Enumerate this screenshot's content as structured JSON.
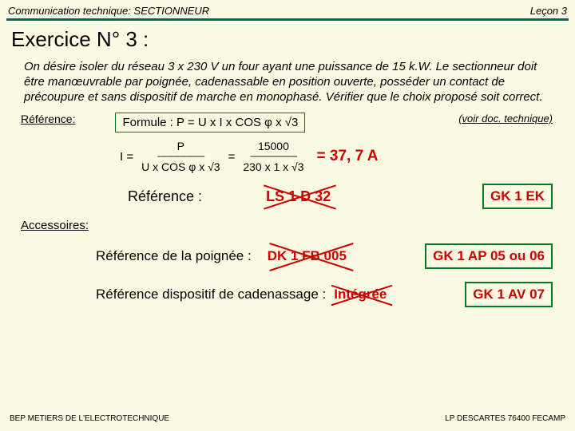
{
  "header": {
    "left": "Communication technique: SECTIONNEUR",
    "right": "Leçon 3"
  },
  "title": "Exercice N° 3 :",
  "prompt": "On désire isoler du réseau 3 x 230 V un four ayant une puissance de 15 k.W. Le sectionneur doit être manœuvrable par poignée, cadenassable en position ouverte, posséder un contact de précoupure et sans dispositif de marche en monophasé. Vérifier que le choix proposé soit correct.",
  "reference_label": "Référence:",
  "formula": "Formule :   P = U x I x COS φ x √3",
  "doc_link": "(voir doc. technique)",
  "calc": {
    "lhs": "I =",
    "num1": "P",
    "den1": "U x COS φ x √3",
    "eq": "=",
    "num2": "15000",
    "den2": "230 x 1 x √3",
    "result": "= 37, 7 A"
  },
  "ref2_label": "Référence :",
  "ref2_answer": "LS 1 D 32",
  "ref2_box": "GK 1 EK",
  "accessories_label": "Accessoires:",
  "handle_label": "Référence de la poignée :",
  "handle_answer": "DK 1 FB 005",
  "handle_box": "GK 1 AP 05 ou 06",
  "lock_label": "Référence dispositif de cadenassage :",
  "lock_answer": "Intégrée",
  "lock_box": "GK 1 AV 07",
  "footer": {
    "left": "BEP METIERS DE L'ELECTROTECHNIQUE",
    "right": "LP DESCARTES 76400 FECAMP"
  }
}
